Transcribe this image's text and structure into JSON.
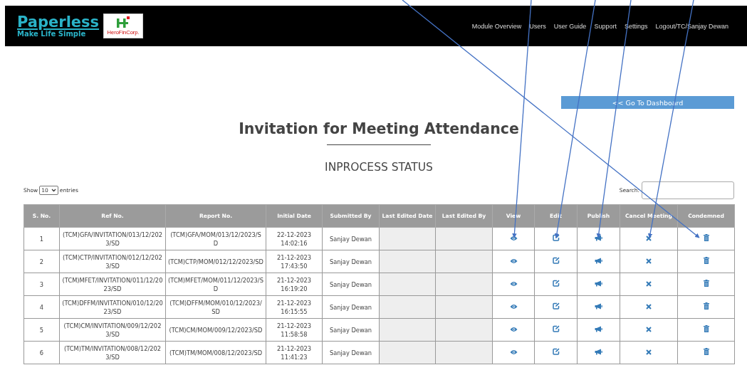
{
  "header": {
    "brand": "Paperless",
    "tagline": "Make Life Simple",
    "partner_logo_text": "HeroFinCorp.",
    "nav": [
      "Module Overview",
      "Users",
      "User Guide",
      "Support",
      "Settings",
      "Logout/TC/Sanjay Dewan"
    ]
  },
  "dashboard_button": "<< Go To Dashboard",
  "title": "Invitation for Meeting Attendance",
  "subtitle": "INPROCESS STATUS",
  "length_control": {
    "before": "Show",
    "value": "10",
    "after": "entries"
  },
  "search": {
    "label": "Search:"
  },
  "table": {
    "columns": [
      {
        "label": "S. No.",
        "kind": "sno"
      },
      {
        "label": "Ref No.",
        "kind": "ref"
      },
      {
        "label": "Report No.",
        "kind": "report"
      },
      {
        "label": "Initial Date",
        "kind": "date"
      },
      {
        "label": "Submitted By",
        "kind": "submitted"
      },
      {
        "label": "Last Edited Date",
        "kind": "blank"
      },
      {
        "label": "Last Edited By",
        "kind": "blank"
      },
      {
        "label": "View",
        "kind": "view"
      },
      {
        "label": "Edit",
        "kind": "edit"
      },
      {
        "label": "Publish",
        "kind": "publish"
      },
      {
        "label": "Cancel Meeting",
        "kind": "cancel"
      },
      {
        "label": "Condemned",
        "kind": "delete"
      }
    ],
    "rows": [
      {
        "sno": "1",
        "ref": "(TCM)GFA/INVITATION/013/12/2023/SD",
        "report": "(TCM)GFA/MOM/013/12/2023/SD",
        "date": "22-12-2023",
        "time": "14:02:16",
        "submitted_by": "Sanjay Dewan"
      },
      {
        "sno": "2",
        "ref": "(TCM)CTP/INVITATION/012/12/2023/SD",
        "report": "(TCM)CTP/MOM/012/12/2023/SD",
        "date": "21-12-2023",
        "time": "17:43:50",
        "submitted_by": "Sanjay Dewan"
      },
      {
        "sno": "3",
        "ref": "(TCM)MFET/INVITATION/011/12/2023/SD",
        "report": "(TCM)MFET/MOM/011/12/2023/SD",
        "date": "21-12-2023",
        "time": "16:19:20",
        "submitted_by": "Sanjay Dewan"
      },
      {
        "sno": "4",
        "ref": "(TCM)DFFM/INVITATION/010/12/2023/SD",
        "report": "(TCM)DFFM/MOM/010/12/2023/SD",
        "date": "21-12-2023",
        "time": "16:15:55",
        "submitted_by": "Sanjay Dewan"
      },
      {
        "sno": "5",
        "ref": "(TCM)CM/INVITATION/009/12/2023/SD",
        "report": "(TCM)CM/MOM/009/12/2023/SD",
        "date": "21-12-2023",
        "time": "11:58:58",
        "submitted_by": "Sanjay Dewan"
      },
      {
        "sno": "6",
        "ref": "(TCM)TM/INVITATION/008/12/2023/SD",
        "report": "(TCM)TM/MOM/008/12/2023/SD",
        "date": "21-12-2023",
        "time": "11:41:23",
        "submitted_by": "Sanjay Dewan"
      }
    ]
  }
}
